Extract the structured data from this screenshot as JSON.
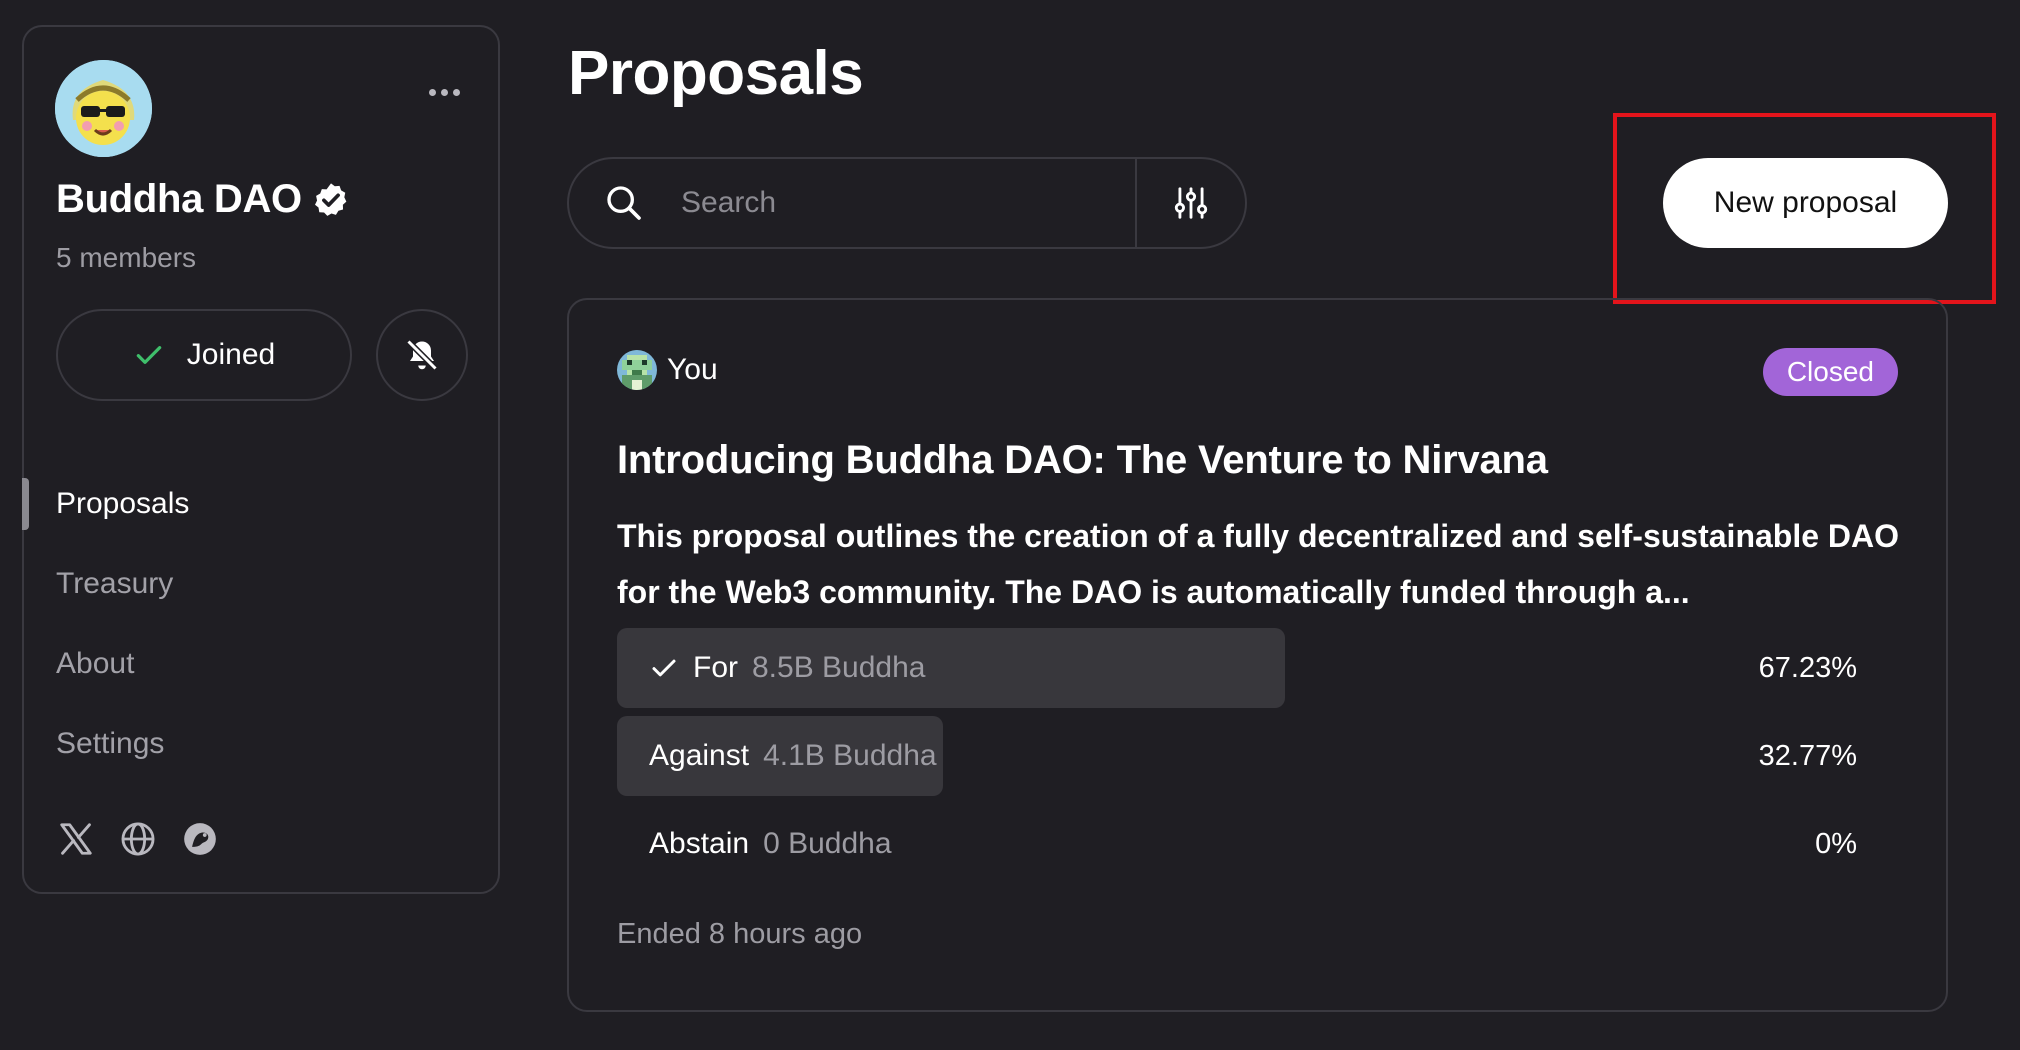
{
  "sidebar": {
    "dao_name": "Buddha DAO",
    "members": "5 members",
    "joined_label": "Joined",
    "nav": [
      {
        "label": "Proposals",
        "active": true
      },
      {
        "label": "Treasury",
        "active": false
      },
      {
        "label": "About",
        "active": false
      },
      {
        "label": "Settings",
        "active": false
      }
    ],
    "socials": [
      "x-icon",
      "globe-icon",
      "discord-icon"
    ]
  },
  "main": {
    "title": "Proposals",
    "search_placeholder": "Search",
    "new_proposal_label": "New proposal"
  },
  "proposal": {
    "author": "You",
    "status": "Closed",
    "status_color": "#a265d8",
    "title": "Introducing Buddha DAO: The Venture to Nirvana",
    "description": "This proposal outlines the creation of a fully decentralized and self-sustainable DAO for the Web3 community. The DAO is automatically funded through a...",
    "votes": [
      {
        "label": "For",
        "amount": "8.5B Buddha",
        "percent": "67.23%",
        "share": 0.5391,
        "selected": true
      },
      {
        "label": "Against",
        "amount": "4.1B Buddha",
        "percent": "32.77%",
        "share": 0.2625,
        "selected": false
      },
      {
        "label": "Abstain",
        "amount": "0 Buddha",
        "percent": "0%",
        "share": 0,
        "selected": false
      }
    ],
    "ended": "Ended 8 hours ago"
  }
}
